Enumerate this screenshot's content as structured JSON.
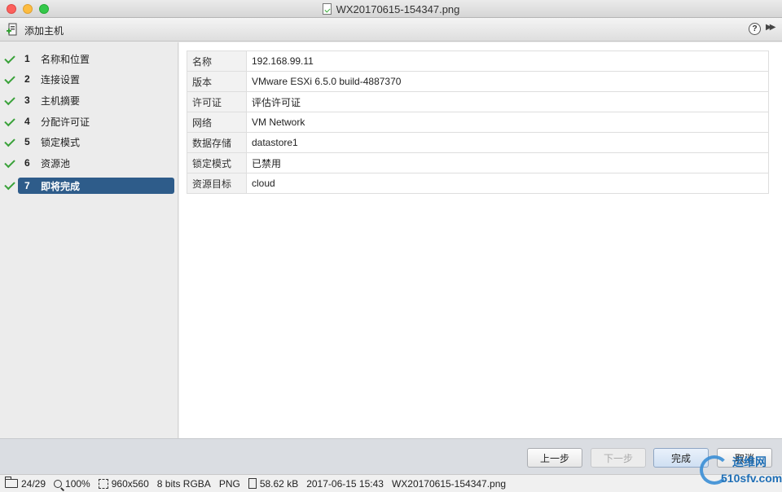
{
  "window": {
    "title": "WX20170615-154347.png"
  },
  "dialog": {
    "title": "添加主机",
    "help": "?",
    "expand": "▶▶"
  },
  "steps": [
    {
      "num": "1",
      "label": "名称和位置",
      "done": true
    },
    {
      "num": "2",
      "label": "连接设置",
      "done": true
    },
    {
      "num": "3",
      "label": "主机摘要",
      "done": true
    },
    {
      "num": "4",
      "label": "分配许可证",
      "done": true
    },
    {
      "num": "5",
      "label": "锁定模式",
      "done": true
    },
    {
      "num": "6",
      "label": "资源池",
      "done": true
    },
    {
      "num": "7",
      "label": "即将完成",
      "done": true,
      "active": true
    }
  ],
  "summary": [
    {
      "key": "名称",
      "value": "192.168.99.11"
    },
    {
      "key": "版本",
      "value": "VMware ESXi 6.5.0 build-4887370"
    },
    {
      "key": "许可证",
      "value": "评估许可证"
    },
    {
      "key": "网络",
      "value": "VM Network"
    },
    {
      "key": "数据存储",
      "value": "datastore1"
    },
    {
      "key": "锁定模式",
      "value": "已禁用"
    },
    {
      "key": "资源目标",
      "value": "cloud"
    }
  ],
  "buttons": {
    "back": "上一步",
    "next": "下一步",
    "finish": "完成",
    "cancel": "取消"
  },
  "statusbar": {
    "index": "24/29",
    "zoom": "100%",
    "dimensions": "960x560",
    "depth": "8 bits RGBA",
    "format": "PNG",
    "size": "58.62 kB",
    "date": "2017-06-15 15:43",
    "filename": "WX20170615-154347.png"
  },
  "watermark": {
    "top": "运维网",
    "bottom": "510sfv.com"
  },
  "colors": {
    "active_step": "#2e5c8a",
    "check": "#3aa23a"
  }
}
